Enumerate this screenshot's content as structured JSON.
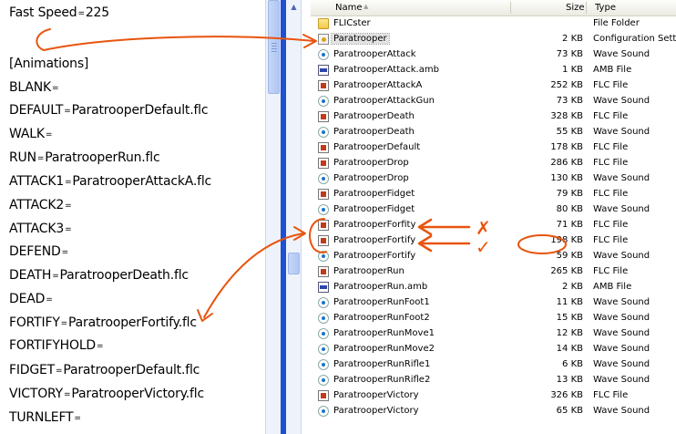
{
  "ini_lines": [
    {
      "key": "Fast Speed",
      "value": "225"
    },
    {
      "key": "",
      "value": ""
    },
    {
      "key": "[Animations]",
      "value": null
    },
    {
      "key": "BLANK",
      "value": ""
    },
    {
      "key": "DEFAULT",
      "value": "ParatrooperDefault.flc"
    },
    {
      "key": "WALK",
      "value": ""
    },
    {
      "key": "RUN",
      "value": "ParatrooperRun.flc"
    },
    {
      "key": "ATTACK1",
      "value": "ParatrooperAttackA.flc"
    },
    {
      "key": "ATTACK2",
      "value": ""
    },
    {
      "key": "ATTACK3",
      "value": ""
    },
    {
      "key": "DEFEND",
      "value": ""
    },
    {
      "key": "DEATH",
      "value": "ParatrooperDeath.flc"
    },
    {
      "key": "DEAD",
      "value": ""
    },
    {
      "key": "FORTIFY",
      "value": "ParatrooperFortify.flc"
    },
    {
      "key": "FORTIFYHOLD",
      "value": ""
    },
    {
      "key": "FIDGET",
      "value": "ParatrooperDefault.flc"
    },
    {
      "key": "VICTORY",
      "value": "ParatrooperVictory.flc"
    },
    {
      "key": "TURNLEFT",
      "value": ""
    }
  ],
  "columns": {
    "name": "Name",
    "size": "Size",
    "type": "Type"
  },
  "files": [
    {
      "name": "FLICster",
      "size": "",
      "type": "File Folder",
      "icon": "folder-icon"
    },
    {
      "name": "Paratrooper",
      "size": "2 KB",
      "type": "Configuration Settings",
      "icon": "config-file-icon",
      "selected": true
    },
    {
      "name": "ParatrooperAttack",
      "size": "73 KB",
      "type": "Wave Sound",
      "icon": "wave-sound-icon"
    },
    {
      "name": "ParatrooperAttack.amb",
      "size": "1 KB",
      "type": "AMB File",
      "icon": "amb-file-icon"
    },
    {
      "name": "ParatrooperAttackA",
      "size": "252 KB",
      "type": "FLC File",
      "icon": "flc-file-icon"
    },
    {
      "name": "ParatrooperAttackGun",
      "size": "73 KB",
      "type": "Wave Sound",
      "icon": "wave-sound-icon"
    },
    {
      "name": "ParatrooperDeath",
      "size": "328 KB",
      "type": "FLC File",
      "icon": "flc-file-icon"
    },
    {
      "name": "ParatrooperDeath",
      "size": "55 KB",
      "type": "Wave Sound",
      "icon": "wave-sound-icon"
    },
    {
      "name": "ParatrooperDefault",
      "size": "178 KB",
      "type": "FLC File",
      "icon": "flc-file-icon"
    },
    {
      "name": "ParatrooperDrop",
      "size": "286 KB",
      "type": "FLC File",
      "icon": "flc-file-icon"
    },
    {
      "name": "ParatrooperDrop",
      "size": "130 KB",
      "type": "Wave Sound",
      "icon": "wave-sound-icon"
    },
    {
      "name": "ParatrooperFidget",
      "size": "79 KB",
      "type": "FLC File",
      "icon": "flc-file-icon"
    },
    {
      "name": "ParatrooperFidget",
      "size": "80 KB",
      "type": "Wave Sound",
      "icon": "wave-sound-icon"
    },
    {
      "name": "ParatrooperForfity",
      "size": "71 KB",
      "type": "FLC File",
      "icon": "flc-file-icon"
    },
    {
      "name": "ParatrooperFortify",
      "size": "198 KB",
      "type": "FLC File",
      "icon": "flc-file-icon"
    },
    {
      "name": "ParatrooperFortify",
      "size": "59 KB",
      "type": "Wave Sound",
      "icon": "wave-sound-icon"
    },
    {
      "name": "ParatrooperRun",
      "size": "265 KB",
      "type": "FLC File",
      "icon": "flc-file-icon"
    },
    {
      "name": "ParatrooperRun.amb",
      "size": "2 KB",
      "type": "AMB File",
      "icon": "amb-file-icon"
    },
    {
      "name": "ParatrooperRunFoot1",
      "size": "11 KB",
      "type": "Wave Sound",
      "icon": "wave-sound-icon"
    },
    {
      "name": "ParatrooperRunFoot2",
      "size": "15 KB",
      "type": "Wave Sound",
      "icon": "wave-sound-icon"
    },
    {
      "name": "ParatrooperRunMove1",
      "size": "12 KB",
      "type": "Wave Sound",
      "icon": "wave-sound-icon"
    },
    {
      "name": "ParatrooperRunMove2",
      "size": "14 KB",
      "type": "Wave Sound",
      "icon": "wave-sound-icon"
    },
    {
      "name": "ParatrooperRunRifle1",
      "size": "6 KB",
      "type": "Wave Sound",
      "icon": "wave-sound-icon"
    },
    {
      "name": "ParatrooperRunRifle2",
      "size": "13 KB",
      "type": "Wave Sound",
      "icon": "wave-sound-icon"
    },
    {
      "name": "ParatrooperVictory",
      "size": "326 KB",
      "type": "FLC File",
      "icon": "flc-file-icon"
    },
    {
      "name": "ParatrooperVictory",
      "size": "65 KB",
      "type": "Wave Sound",
      "icon": "wave-sound-icon"
    }
  ],
  "annotations": {
    "color": "#e8540e",
    "wrong_mark": "✗",
    "right_mark": "✓"
  }
}
